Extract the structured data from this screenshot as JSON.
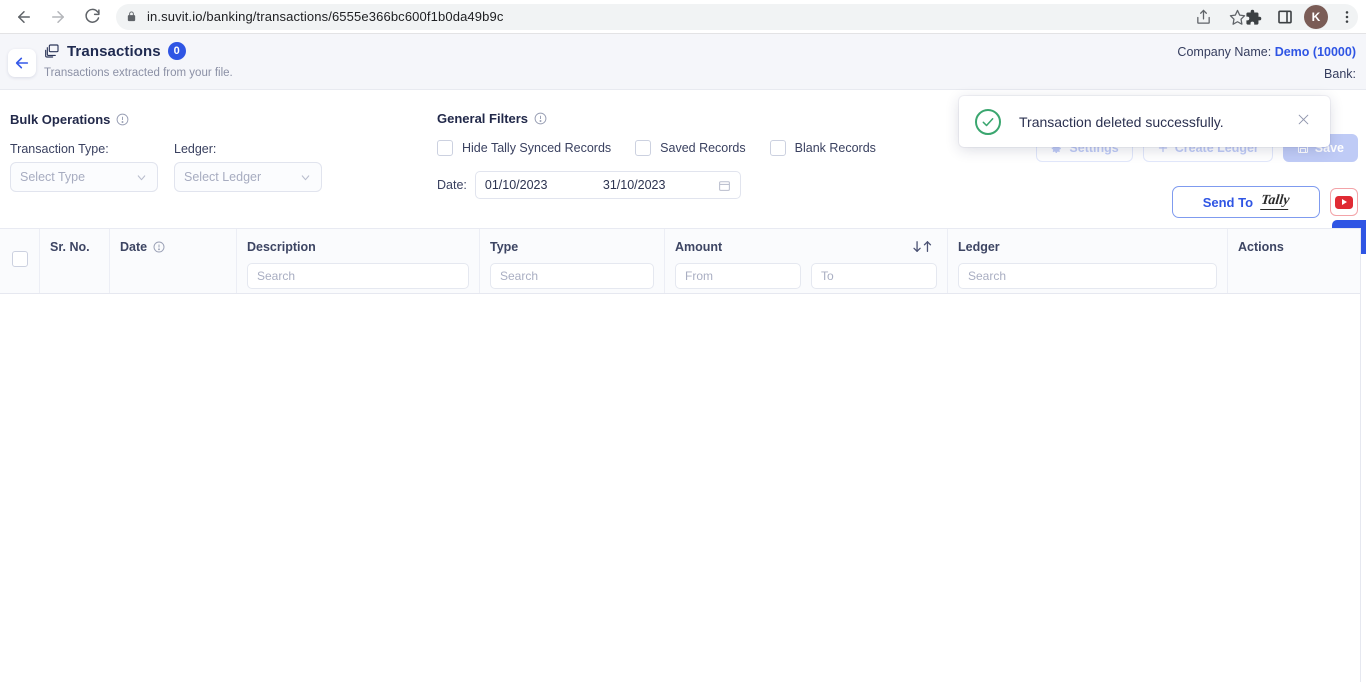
{
  "browser": {
    "url": "in.suvit.io/banking/transactions/6555e366bc600f1b0da49b9c",
    "back_icon": "arrow-left-icon",
    "forward_icon": "arrow-right-icon",
    "reload_icon": "reload-icon",
    "lock_icon": "lock-icon",
    "share_icon": "share-icon",
    "bookmark_icon": "star-icon",
    "extensions_icon": "puzzle-icon",
    "sidepanel_icon": "side-panel-icon",
    "profile_initial": "K",
    "menu_icon": "three-dot-menu-icon"
  },
  "header": {
    "back_icon": "arrow-left-icon",
    "page_icon": "transactions-icon",
    "title": "Transactions",
    "count": "0",
    "subtitle": "Transactions extracted from your file.",
    "company_label": "Company Name:",
    "company_value": "Demo (10000)",
    "bank_label": "Bank:"
  },
  "bulk_operations": {
    "title": "Bulk Operations",
    "info_icon": "info-icon",
    "transaction_type_label": "Transaction Type:",
    "transaction_type_value": "Select Type",
    "ledger_label": "Ledger:",
    "ledger_value": "Select Ledger",
    "caret_icon": "chevron-down-icon"
  },
  "general_filters": {
    "title": "General Filters",
    "info_icon": "info-icon",
    "checkboxes": [
      {
        "label": "Hide Tally Synced Records",
        "checked": false
      },
      {
        "label": "Saved Records",
        "checked": false
      },
      {
        "label": "Blank Records",
        "checked": false
      }
    ],
    "date_label": "Date:",
    "date_from": "01/10/2023",
    "date_to": "31/10/2023",
    "calendar_icon": "calendar-icon"
  },
  "actions": {
    "settings_label": "Settings",
    "settings_icon": "gear-icon",
    "create_ledger_label": "Create Ledger",
    "create_ledger_icon": "plus-icon",
    "save_label": "Save",
    "save_icon": "save-icon",
    "send_to_label": "Send To",
    "send_to_brand": "Tally",
    "youtube_icon": "youtube-icon",
    "collapse_icon": "double-chevron-left-icon"
  },
  "table": {
    "select_all_checkbox": "select-all-checkbox",
    "columns": [
      {
        "label": "Sr. No."
      },
      {
        "label": "Date",
        "info_icon": "info-icon"
      },
      {
        "label": "Description",
        "search_placeholder": "Search"
      },
      {
        "label": "Type",
        "search_placeholder": "Search"
      },
      {
        "label": "Amount",
        "from_placeholder": "From",
        "to_placeholder": "To",
        "sort_icon": "sort-arrows-icon"
      },
      {
        "label": "Ledger",
        "search_placeholder": "Search"
      },
      {
        "label": "Actions"
      }
    ],
    "rows": []
  },
  "toast": {
    "status_icon": "check-circle-icon",
    "message": "Transaction deleted successfully.",
    "close_icon": "close-icon"
  },
  "colors": {
    "accent": "#2f55e4",
    "success": "#3aa66f",
    "danger": "#e02a33",
    "header_bg": "#f5f6fa"
  }
}
